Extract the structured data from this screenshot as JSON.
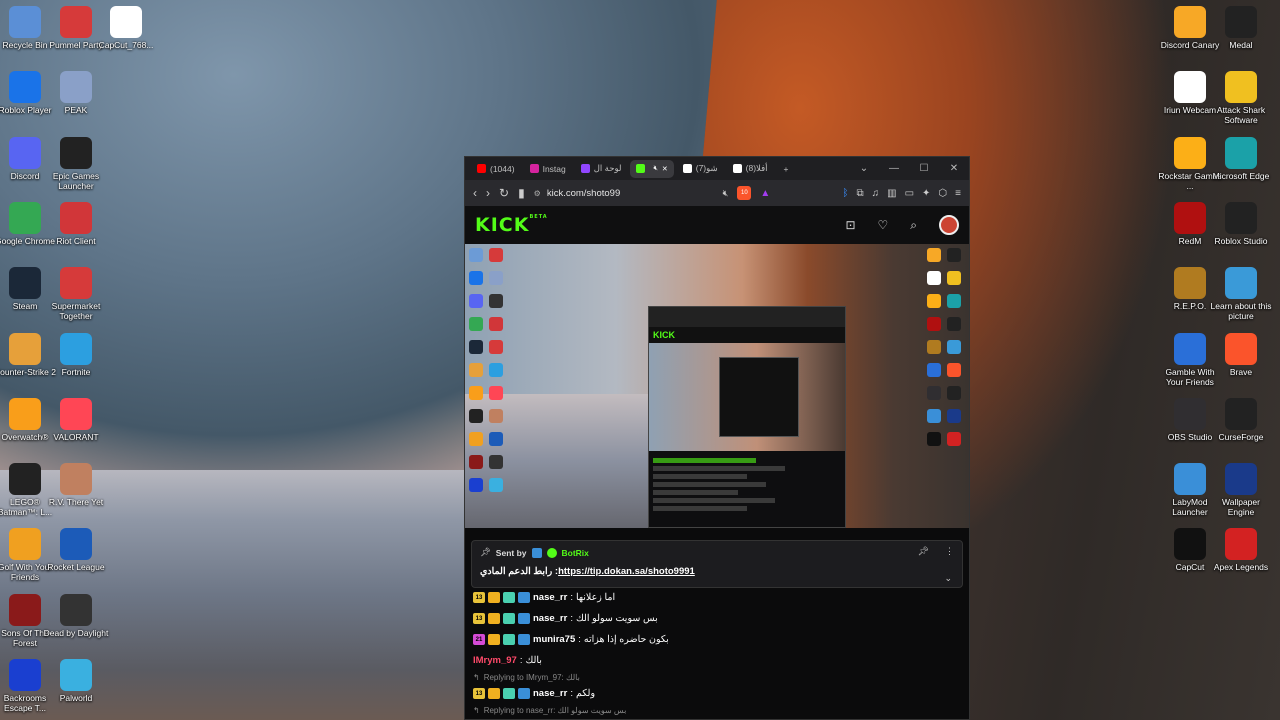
{
  "desktop": {
    "left_col1": [
      {
        "label": "Recycle Bin",
        "icon": "recycle-bin-icon",
        "color": "#5b8fd6"
      },
      {
        "label": "Roblox Player",
        "icon": "roblox-icon",
        "color": "#1a73e8"
      },
      {
        "label": "Discord",
        "icon": "discord-icon",
        "color": "#5865f2"
      },
      {
        "label": "Google Chrome",
        "icon": "chrome-icon",
        "color": "#34a853"
      },
      {
        "label": "Steam",
        "icon": "steam-icon",
        "color": "#1b2838"
      },
      {
        "label": "Counter-Strike 2",
        "icon": "counter-strike-icon",
        "color": "#e6a03a"
      },
      {
        "label": "Overwatch®",
        "icon": "overwatch-icon",
        "color": "#f99e1a"
      },
      {
        "label": "LEGO® Batman™: L...",
        "icon": "lego-batman-icon",
        "color": "#222"
      },
      {
        "label": "Golf With Your Friends",
        "icon": "golf-icon",
        "color": "#f0a020"
      },
      {
        "label": "Sons Of The Forest",
        "icon": "sons-forest-icon",
        "color": "#8a1a1a"
      },
      {
        "label": "Backrooms Escape T...",
        "icon": "backrooms-icon",
        "color": "#1a3fd0"
      }
    ],
    "left_col2": [
      {
        "label": "Pummel Party",
        "icon": "pummel-party-icon",
        "color": "#d63a3a"
      },
      {
        "label": "PEAK",
        "icon": "peak-icon",
        "color": "#8aa0c8"
      },
      {
        "label": "Epic Games Launcher",
        "icon": "epic-games-icon",
        "color": "#222"
      },
      {
        "label": "Riot Client",
        "icon": "riot-icon",
        "color": "#d13639"
      },
      {
        "label": "Supermarket Together",
        "icon": "supermarket-icon",
        "color": "#d63a3a"
      },
      {
        "label": "Fortnite",
        "icon": "fortnite-icon",
        "color": "#2c9fe0"
      },
      {
        "label": "VALORANT",
        "icon": "valorant-icon",
        "color": "#ff4655"
      },
      {
        "label": "R.V. There Yet",
        "icon": "rv-icon",
        "color": "#c08060"
      },
      {
        "label": "Rocket League",
        "icon": "rocket-league-icon",
        "color": "#1c5bb8"
      },
      {
        "label": "Dead by Daylight",
        "icon": "dbd-icon",
        "color": "#333"
      },
      {
        "label": "Palworld",
        "icon": "palworld-icon",
        "color": "#3ab0e0"
      }
    ],
    "left_col3": [
      {
        "label": "CapCut_768...",
        "icon": "capcut-icon",
        "color": "#fff"
      }
    ],
    "right_col1": [
      {
        "label": "Discord Canary",
        "icon": "discord-canary-icon",
        "color": "#f7a826"
      },
      {
        "label": "Iriun Webcam",
        "icon": "iriun-icon",
        "color": "#fff"
      },
      {
        "label": "Rockstar Games ...",
        "icon": "rockstar-icon",
        "color": "#fcaf17"
      },
      {
        "label": "RedM",
        "icon": "redm-icon",
        "color": "#b01010"
      },
      {
        "label": "R.E.P.O.",
        "icon": "repo-icon",
        "color": "#b07b20"
      },
      {
        "label": "Gamble With Your Friends",
        "icon": "gamble-icon",
        "color": "#2a6fd8"
      },
      {
        "label": "OBS Studio",
        "icon": "obs-icon",
        "color": "#302e31"
      },
      {
        "label": "LabyMod Launcher",
        "icon": "labymod-icon",
        "color": "#3a8fd8"
      },
      {
        "label": "CapCut",
        "icon": "capcut-icon",
        "color": "#111"
      }
    ],
    "right_col2": [
      {
        "label": "Medal",
        "icon": "medal-icon",
        "color": "#222"
      },
      {
        "label": "Attack Shark Software",
        "icon": "attack-shark-icon",
        "color": "#f0c020"
      },
      {
        "label": "Microsoft Edge",
        "icon": "edge-icon",
        "color": "#1ba1a8"
      },
      {
        "label": "Roblox Studio",
        "icon": "roblox-studio-icon",
        "color": "#222"
      },
      {
        "label": "Learn about this picture",
        "icon": "learn-picture-icon",
        "color": "#3a9ad8"
      },
      {
        "label": "Brave",
        "icon": "brave-icon",
        "color": "#fb542b"
      },
      {
        "label": "CurseForge",
        "icon": "curseforge-icon",
        "color": "#222"
      },
      {
        "label": "Wallpaper Engine",
        "icon": "wallpaper-engine-icon",
        "color": "#1a3a8a"
      },
      {
        "label": "Apex Legends",
        "icon": "apex-icon",
        "color": "#d32222"
      }
    ]
  },
  "browser": {
    "tabs": [
      {
        "label": "(1044)",
        "icon": "youtube-icon",
        "color": "#ff0000"
      },
      {
        "label": "Instag",
        "icon": "instagram-icon",
        "color": "#d6249f"
      },
      {
        "label": "لوحة ال",
        "icon": "twitch-icon",
        "color": "#9146ff"
      },
      {
        "label": "",
        "icon": "kick-icon",
        "color": "#53fc18",
        "active": true
      },
      {
        "label": "(7)شو",
        "icon": "tiktok-icon",
        "color": "#fff"
      },
      {
        "label": "(8)أفلا",
        "icon": "tiktok-icon",
        "color": "#fff"
      }
    ],
    "new_tab_label": "+",
    "url": "kick.com/shoto99",
    "brave_shield_count": "10"
  },
  "kick": {
    "logo": "KICK",
    "logo_beta": "BETA"
  },
  "pinned": {
    "sent_by_label": "Sent by",
    "bot_name": "BotRix",
    "message_prefix": "رابط الدعم المادي :",
    "link": "https://tip.dokan.sa/shoto9991"
  },
  "chat": [
    {
      "type": "msg",
      "level": "13",
      "level_color": "#e8c33a",
      "user": "nase_rr",
      "user_color": "#ffffff",
      "text": "اما زعلانها"
    },
    {
      "type": "msg",
      "level": "13",
      "level_color": "#e8c33a",
      "user": "nase_rr",
      "user_color": "#ffffff",
      "text": "بس سويت سولو الك"
    },
    {
      "type": "msg",
      "level": "21",
      "level_color": "#d64bd6",
      "user": "munira75",
      "user_color": "#ffffff",
      "text": "بكون حاضره إذا هزاته"
    },
    {
      "type": "msg",
      "level": "",
      "level_color": "",
      "user": "IMrym_97",
      "user_color": "#ff4a6a",
      "text": "بالك"
    },
    {
      "type": "reply",
      "text": "Replying to IMrym_97: بالك"
    },
    {
      "type": "msg",
      "level": "13",
      "level_color": "#e8c33a",
      "user": "nase_rr",
      "user_color": "#ffffff",
      "text": "ولكم"
    },
    {
      "type": "reply",
      "text": "Replying to nase_rr: بس سويت سولو الك"
    }
  ]
}
